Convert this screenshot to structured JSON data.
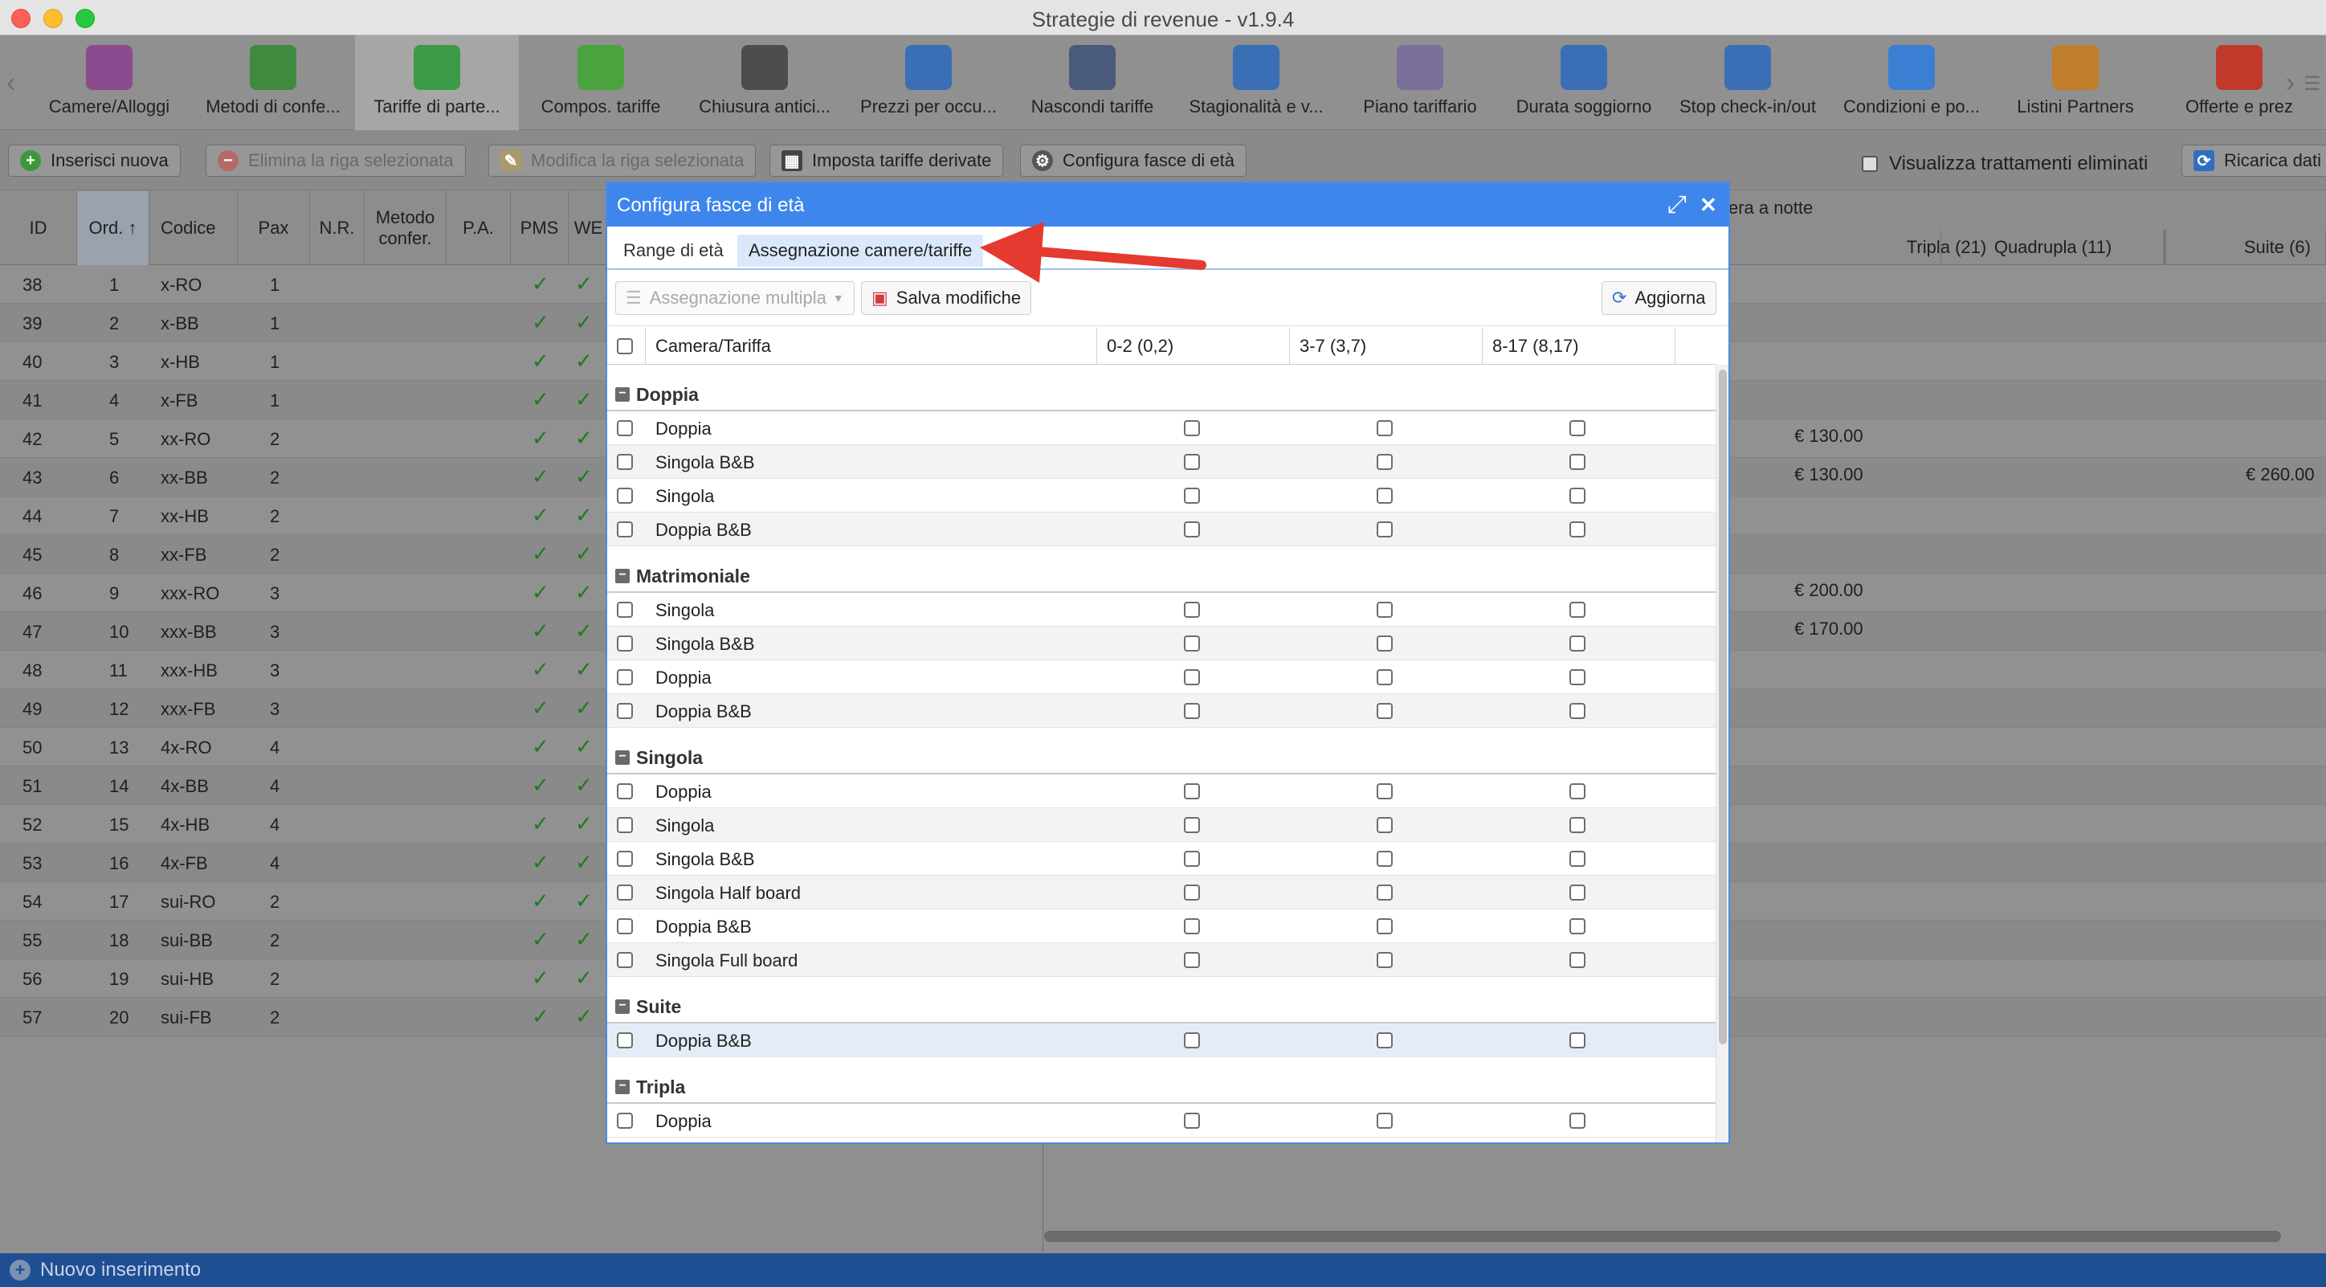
{
  "window": {
    "title": "Strategie di revenue - v1.9.4"
  },
  "toolbar": {
    "items": [
      {
        "label": "Camere/Alloggi",
        "icon": "bed-icon",
        "color": "#8a4b8f"
      },
      {
        "label": "Metodi di confe...",
        "icon": "money-icon",
        "color": "#3f8a3f"
      },
      {
        "label": "Tariffe di parte...",
        "icon": "price-tag-icon",
        "color": "#3c9b48"
      },
      {
        "label": "Compos. tariffe",
        "icon": "puzzle-icon",
        "color": "#4aa33f"
      },
      {
        "label": "Chiusura antici...",
        "icon": "stopwatch-icon",
        "color": "#4d4d4d"
      },
      {
        "label": "Prezzi per occu...",
        "icon": "bar-chart-icon",
        "color": "#3a6fb5"
      },
      {
        "label": "Nascondi tariffe",
        "icon": "hidden-calendar-icon",
        "color": "#4a5a7a"
      },
      {
        "label": "Stagionalità e v...",
        "icon": "calendar-arrows-icon",
        "color": "#3a6fb5"
      },
      {
        "label": "Piano tariffario",
        "icon": "calendar-grid-icon",
        "color": "#7a6f9a"
      },
      {
        "label": "Durata soggiorno",
        "icon": "calendar-icon",
        "color": "#3a6fb5"
      },
      {
        "label": "Stop check-in/out",
        "icon": "calendar-block-icon",
        "color": "#3a6fb5"
      },
      {
        "label": "Condizioni e po...",
        "icon": "document-icon",
        "color": "#3a7fd4"
      },
      {
        "label": "Listini Partners",
        "icon": "handshake-icon",
        "color": "#c07d2b"
      },
      {
        "label": "Offerte e prez",
        "icon": "discount-badge-icon",
        "color": "#c0392b"
      }
    ],
    "active_index": 2,
    "prev_symbol": "‹",
    "next_symbol": "›",
    "overflow_symbol": "☰"
  },
  "actionbar": {
    "insert": "Inserisci nuova",
    "delete": "Elimina la riga selezionata",
    "modify": "Modifica la riga selezionata",
    "derived": "Imposta tariffe derivate",
    "age_bands": "Configura fasce di età",
    "show_deleted": "Visualizza trattamenti eliminati",
    "reload": "Ricarica dati"
  },
  "grid": {
    "columns": [
      "ID",
      "Ord.",
      "Codice",
      "Pax",
      "N.R.",
      "Metodo confer.",
      "P.A.",
      "PMS",
      "WE"
    ],
    "sort_indicator": "↑",
    "rows": [
      {
        "id": "38",
        "ord": "1",
        "code": "x-RO",
        "pax": "1"
      },
      {
        "id": "39",
        "ord": "2",
        "code": "x-BB",
        "pax": "1"
      },
      {
        "id": "40",
        "ord": "3",
        "code": "x-HB",
        "pax": "1"
      },
      {
        "id": "41",
        "ord": "4",
        "code": "x-FB",
        "pax": "1"
      },
      {
        "id": "42",
        "ord": "5",
        "code": "xx-RO",
        "pax": "2"
      },
      {
        "id": "43",
        "ord": "6",
        "code": "xx-BB",
        "pax": "2"
      },
      {
        "id": "44",
        "ord": "7",
        "code": "xx-HB",
        "pax": "2"
      },
      {
        "id": "45",
        "ord": "8",
        "code": "xx-FB",
        "pax": "2"
      },
      {
        "id": "46",
        "ord": "9",
        "code": "xxx-RO",
        "pax": "3"
      },
      {
        "id": "47",
        "ord": "10",
        "code": "xxx-BB",
        "pax": "3"
      },
      {
        "id": "48",
        "ord": "11",
        "code": "xxx-HB",
        "pax": "3"
      },
      {
        "id": "49",
        "ord": "12",
        "code": "xxx-FB",
        "pax": "3"
      },
      {
        "id": "50",
        "ord": "13",
        "code": "4x-RO",
        "pax": "4"
      },
      {
        "id": "51",
        "ord": "14",
        "code": "4x-BB",
        "pax": "4"
      },
      {
        "id": "52",
        "ord": "15",
        "code": "4x-HB",
        "pax": "4"
      },
      {
        "id": "53",
        "ord": "16",
        "code": "4x-FB",
        "pax": "4"
      },
      {
        "id": "54",
        "ord": "17",
        "code": "sui-RO",
        "pax": "2"
      },
      {
        "id": "55",
        "ord": "18",
        "code": "sui-BB",
        "pax": "2"
      },
      {
        "id": "56",
        "ord": "19",
        "code": "sui-HB",
        "pax": "2"
      },
      {
        "id": "57",
        "ord": "20",
        "code": "sui-FB",
        "pax": "2"
      }
    ],
    "check_symbol": "✓",
    "right_title": "era a notte",
    "right_columns": [
      "Tripla (21)",
      "Quadrupla (11)",
      "Suite (6)"
    ],
    "prices": {
      "r4_tripla": "€ 130.00",
      "r5_tripla": "€ 130.00",
      "r5_suite": "€ 260.00",
      "r8_tripla": "€ 200.00",
      "r9_tripla": "€ 170.00"
    }
  },
  "statusbar": {
    "text": "Nuovo inserimento",
    "icon": "+"
  },
  "modal": {
    "title": "Configura fasce di età",
    "maximize_symbol": "⤢",
    "close_symbol": "✕",
    "tabs": [
      "Range di età",
      "Assegnazione camere/tariffe"
    ],
    "active_tab": 1,
    "buttons": {
      "multi_assign": "Assegnazione multipla",
      "save": "Salva modifiche",
      "refresh": "Aggiorna"
    },
    "columns": [
      "Camera/Tariffa",
      "0-2 (0,2)",
      "3-7 (3,7)",
      "8-17 (8,17)"
    ],
    "groups": [
      {
        "name": "Doppia",
        "rows": [
          "Doppia",
          "Singola B&B",
          "Singola",
          "Doppia B&B"
        ]
      },
      {
        "name": "Matrimoniale",
        "rows": [
          "Singola",
          "Singola B&B",
          "Doppia",
          "Doppia B&B"
        ]
      },
      {
        "name": "Singola",
        "rows": [
          "Doppia",
          "Singola",
          "Singola B&B",
          "Singola Half board",
          "Doppia B&B",
          "Singola Full board"
        ]
      },
      {
        "name": "Suite",
        "rows": [
          "Doppia B&B"
        ]
      },
      {
        "name": "Tripla",
        "rows": [
          "Doppia"
        ]
      }
    ],
    "collapse_symbol": "−"
  },
  "annotation": {
    "arrow_color": "#e53a2f"
  }
}
